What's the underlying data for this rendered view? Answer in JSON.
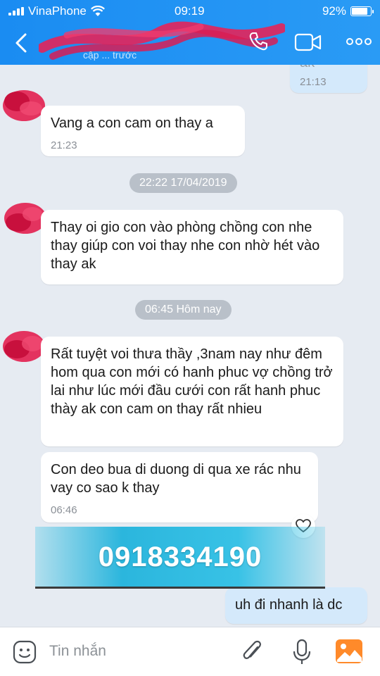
{
  "status_bar": {
    "carrier": "VinaPhone",
    "time": "09:19",
    "battery": "92%",
    "battery_level": 0.92
  },
  "header": {
    "back_icon": "back-chevron-icon",
    "subtitle": "cập ... trước",
    "icons": [
      "phone-icon",
      "video-call-icon",
      "more-icon"
    ]
  },
  "messages": [
    {
      "from": "me",
      "text": "ak",
      "time": "21:13"
    },
    {
      "from": "other",
      "text": "Vang a con cam on thay a",
      "time": "21:23"
    },
    {
      "type": "separator",
      "text": "22:22 17/04/2019"
    },
    {
      "from": "other",
      "text": "Thay oi gio con vào phòng chồng con nhe thay giúp con voi thay nhe con nhờ hét vào thay ak",
      "time": ""
    },
    {
      "type": "separator",
      "text": "06:45 Hôm nay"
    },
    {
      "from": "other",
      "text": "Rất tuyệt voi thưa thầy ,3nam nay như đêm hom qua con mới có hanh phuc vợ chồng trở lai như lúc mới đầu cưới con rất hanh phuc thày ak con cam on thay rất nhieu",
      "time": ""
    },
    {
      "from": "other",
      "text": "Con deo bua di duong di qua xe rác nhu vay co sao k thay",
      "time": "06:46"
    },
    {
      "from": "me",
      "text": "uh đi nhanh là dc",
      "time": ""
    }
  ],
  "overlay_banner": {
    "text": "0918334190"
  },
  "input_bar": {
    "placeholder": "Tin nhắn",
    "icons": [
      "sticker-icon",
      "attach-icon",
      "microphone-icon",
      "image-icon"
    ]
  },
  "colors": {
    "header": "#1a8cf2",
    "chat_bg": "#e6ebf2",
    "my_bubble": "#d4e9fb",
    "banner": "#2bb6dd"
  }
}
